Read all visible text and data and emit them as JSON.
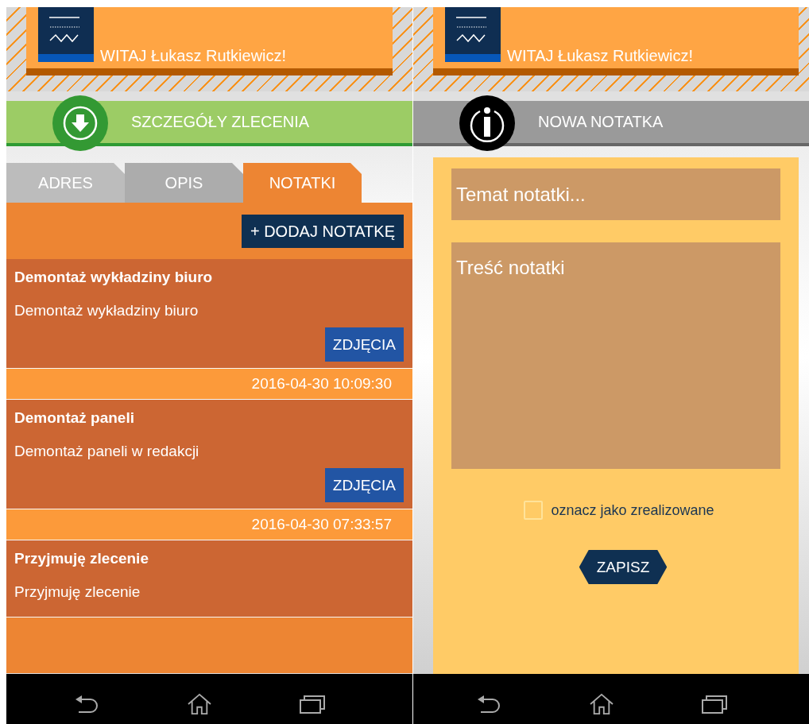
{
  "order_screen": {
    "greeting": "WITAJ Łukasz Rutkiewicz!",
    "section_title": "SZCZEGÓŁY ZLECENIA",
    "tabs": [
      {
        "label": "ADRES",
        "selected": false
      },
      {
        "label": "OPIS",
        "selected": false
      },
      {
        "label": "NOTATKI",
        "selected": true
      }
    ],
    "add_button": "+ DODAJ NOTATKĘ",
    "notes": [
      {
        "title": "Demontaż wykładziny biuro",
        "body": "Demontaż wykładziny biuro",
        "photos_button": "ZDJĘCIA"
      },
      {
        "date": "2016-04-30 10:09:30",
        "title": "Demontaż paneli",
        "body": "Demontaż paneli w redakcji",
        "photos_button": "ZDJĘCIA"
      },
      {
        "date": "2016-04-30 07:33:57",
        "title": "Przyjmuję zlecenie",
        "body": "Przyjmuję zlecenie"
      }
    ]
  },
  "note_screen": {
    "greeting": "WITAJ Łukasz Rutkiewicz!",
    "section_title": "NOWA NOTATKA",
    "subject": {
      "placeholder": "Temat notatki..."
    },
    "content": {
      "placeholder": "Treść notatki"
    },
    "done_checkbox": {
      "label": "oznacz jako zrealizowane",
      "checked": false
    },
    "save_button": "ZAPISZ"
  }
}
